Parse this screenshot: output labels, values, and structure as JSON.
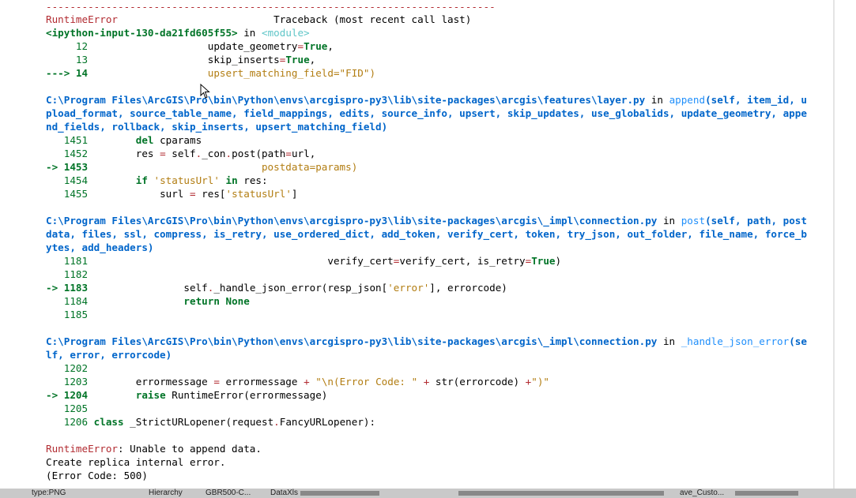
{
  "traceback": {
    "separator": "---------------------------------------------------------------------------",
    "error_name": "RuntimeError",
    "header": "Traceback (most recent call last)",
    "cells": [
      {
        "location": "<ipython-input-130-da21fd605f55>",
        "in_word": " in ",
        "func": "<module>",
        "lines": [
          {
            "num": "     12",
            "code": "update_geometry=True,"
          },
          {
            "num": "     13",
            "code": "skip_inserts=True,"
          },
          {
            "num": "---> 14",
            "code": "upsert_matching_field=\"FID\")"
          }
        ]
      },
      {
        "path": "C:\\Program Files\\ArcGIS\\Pro\\bin\\Python\\envs\\arcgispro-py3\\lib\\site-packages\\arcgis\\features\\layer.py",
        "in_word": " in ",
        "func": "append",
        "sig1": "(self, item_id, u",
        "sig2": "pload_format, source_table_name, field_mappings, edits, source_info, upsert, skip_updates, use_globalids, update_geometry, appe",
        "sig3": "nd_fields, rollback, skip_inserts, upsert_matching_field)",
        "lines": [
          {
            "num": "   1451",
            "code": "        del cparams"
          },
          {
            "num": "   1452",
            "code": "        res = self._con.post(path=url,"
          },
          {
            "num": "-> 1453",
            "code": "                             postdata=params)"
          },
          {
            "num": "   1454",
            "code": "        if 'statusUrl' in res:"
          },
          {
            "num": "   1455",
            "code": "            surl = res['statusUrl']"
          }
        ]
      },
      {
        "path": "C:\\Program Files\\ArcGIS\\Pro\\bin\\Python\\envs\\arcgispro-py3\\lib\\site-packages\\arcgis\\_impl\\connection.py",
        "in_word": " in ",
        "func": "post",
        "sig1": "(self, path, post",
        "sig2": "data, files, ssl, compress, is_retry, use_ordered_dict, add_token, verify_cert, token, try_json, out_folder, file_name, force_b",
        "sig3": "ytes, add_headers)",
        "lines": [
          {
            "num": "   1181",
            "code": "                                        verify_cert=verify_cert, is_retry=True)"
          },
          {
            "num": "   1182",
            "code": ""
          },
          {
            "num": "-> 1183",
            "code": "                self._handle_json_error(resp_json['error'], errorcode)"
          },
          {
            "num": "   1184",
            "code": "                return None"
          },
          {
            "num": "   1185",
            "code": ""
          }
        ]
      },
      {
        "path": "C:\\Program Files\\ArcGIS\\Pro\\bin\\Python\\envs\\arcgispro-py3\\lib\\site-packages\\arcgis\\_impl\\connection.py",
        "in_word": " in ",
        "func": "_handle_json_error",
        "sig1": "(se",
        "sig2": "lf, error, errorcode)",
        "lines": [
          {
            "num": "   1202",
            "code": ""
          },
          {
            "num": "   1203",
            "code": "        errormessage = errormessage + \"\\n(Error Code: \" + str(errorcode) +\")\""
          },
          {
            "num": "-> 1204",
            "code": "        raise RuntimeError(errormessage)"
          },
          {
            "num": "   1205",
            "code": ""
          },
          {
            "num": "   1206",
            "code": "class _StrictURLopener(request.FancyURLopener):"
          }
        ]
      }
    ],
    "final_error": {
      "name": "RuntimeError",
      "message": ": Unable to append data.",
      "line2": "Create replica internal error.",
      "line3": "(Error Code: 500)"
    }
  },
  "taskbar": {
    "items": [
      "type:PNG",
      "Hierarchy",
      "GBR500-C...",
      "DataXls",
      "ave_Custo..."
    ]
  }
}
